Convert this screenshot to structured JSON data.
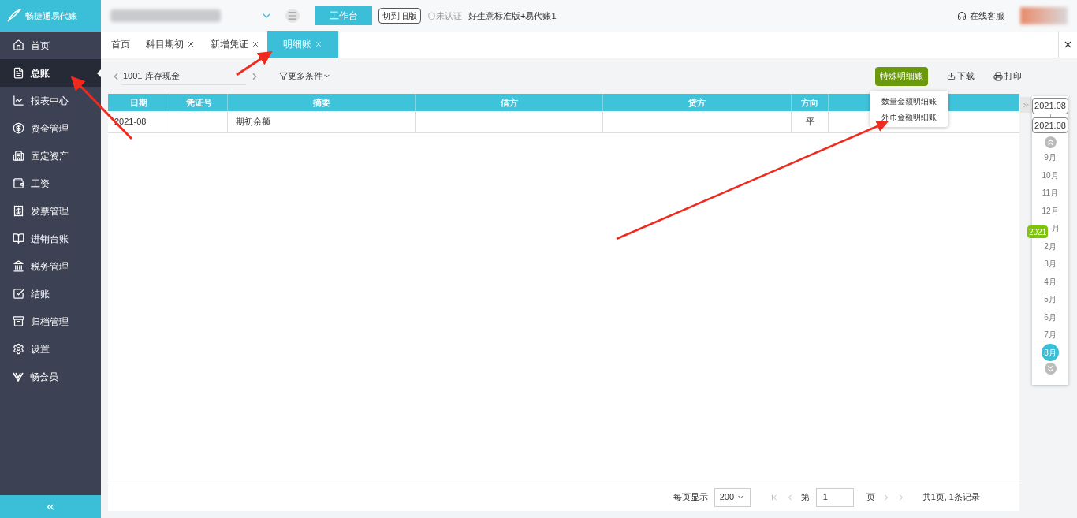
{
  "sidebar": {
    "logo": "畅捷通易代账",
    "items": [
      {
        "label": "首页",
        "selected": false
      },
      {
        "label": "总账",
        "selected": true
      },
      {
        "label": "报表中心",
        "selected": false
      },
      {
        "label": "资金管理",
        "selected": false
      },
      {
        "label": "固定资产",
        "selected": false
      },
      {
        "label": "工资",
        "selected": false
      },
      {
        "label": "发票管理",
        "selected": false
      },
      {
        "label": "进销台账",
        "selected": false
      },
      {
        "label": "税务管理",
        "selected": false
      },
      {
        "label": "结账",
        "selected": false
      },
      {
        "label": "归档管理",
        "selected": false
      },
      {
        "label": "设置",
        "selected": false
      },
      {
        "label": "畅会员",
        "selected": false
      }
    ]
  },
  "topbar": {
    "workbench": "工作台",
    "old_version": "切到旧版",
    "cert": "未认证",
    "edition": "好生意标准版+易代账1",
    "support": "在线客服"
  },
  "tabs": [
    {
      "label": "首页",
      "closable": false,
      "selected": false
    },
    {
      "label": "科目期初",
      "closable": true,
      "selected": false
    },
    {
      "label": "新增凭证",
      "closable": true,
      "selected": false
    },
    {
      "label": "明细账",
      "closable": true,
      "selected": true
    }
  ],
  "toolbar": {
    "account": "1001 库存现金",
    "more": "更多条件",
    "special": "特殊明细账",
    "download": "下载",
    "print": "打印"
  },
  "menu": [
    "数量金额明细账",
    "外币金额明细账"
  ],
  "table": {
    "columns": [
      "日期",
      "凭证号",
      "摘要",
      "借方",
      "贷方",
      "方向",
      ""
    ],
    "rows": [
      [
        "2021-08",
        "",
        "期初余额",
        "",
        "",
        "平",
        ""
      ]
    ]
  },
  "period": {
    "start": "2021.08",
    "end": "2021.08",
    "year": "2021",
    "months": [
      {
        "label": "9月",
        "selected": false
      },
      {
        "label": "10月",
        "selected": false
      },
      {
        "label": "11月",
        "selected": false
      },
      {
        "label": "12月",
        "selected": false
      },
      {
        "label": "月",
        "selected": false
      },
      {
        "label": "2月",
        "selected": false
      },
      {
        "label": "3月",
        "selected": false
      },
      {
        "label": "4月",
        "selected": false
      },
      {
        "label": "5月",
        "selected": false
      },
      {
        "label": "6月",
        "selected": false
      },
      {
        "label": "7月",
        "selected": false
      },
      {
        "label": "8月",
        "selected": true
      }
    ]
  },
  "pager": {
    "per_page_label": "每页显示",
    "per_page": "200",
    "page_prefix": "第",
    "page": "1",
    "page_suffix": "页",
    "summary": "共1页, 1条记录"
  }
}
